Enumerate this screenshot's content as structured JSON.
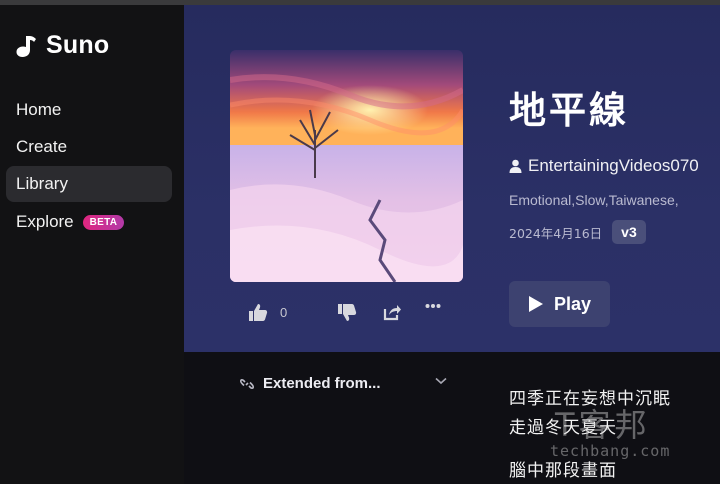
{
  "app": {
    "name": "Suno"
  },
  "sidebar": {
    "items": [
      {
        "label": "Home"
      },
      {
        "label": "Create"
      },
      {
        "label": "Library"
      },
      {
        "label": "Explore"
      }
    ],
    "explore_badge": "BETA"
  },
  "song": {
    "title": "地平線",
    "artist": "EntertainingVideos070",
    "tags": "Emotional,Slow,Taiwanese,",
    "date": "2024年4月16日",
    "version": "v3",
    "likes": "0",
    "play_label": "Play",
    "extended_label": "Extended from..."
  },
  "lyrics": [
    "四季正在妄想中沉眠",
    "走過冬天夏天",
    "腦中那段畫面"
  ],
  "watermark": {
    "big": "T客邦",
    "small": "techbang.com"
  },
  "colors": {
    "accent": "#e0267f",
    "hero_bg": "#2b3066",
    "sidebar_bg": "#121214"
  },
  "icons": [
    "suno-logo-icon",
    "thumbs-up-icon",
    "thumbs-down-icon",
    "share-icon",
    "more-icon",
    "user-icon",
    "play-icon",
    "link-icon",
    "chevron-down-icon"
  ]
}
